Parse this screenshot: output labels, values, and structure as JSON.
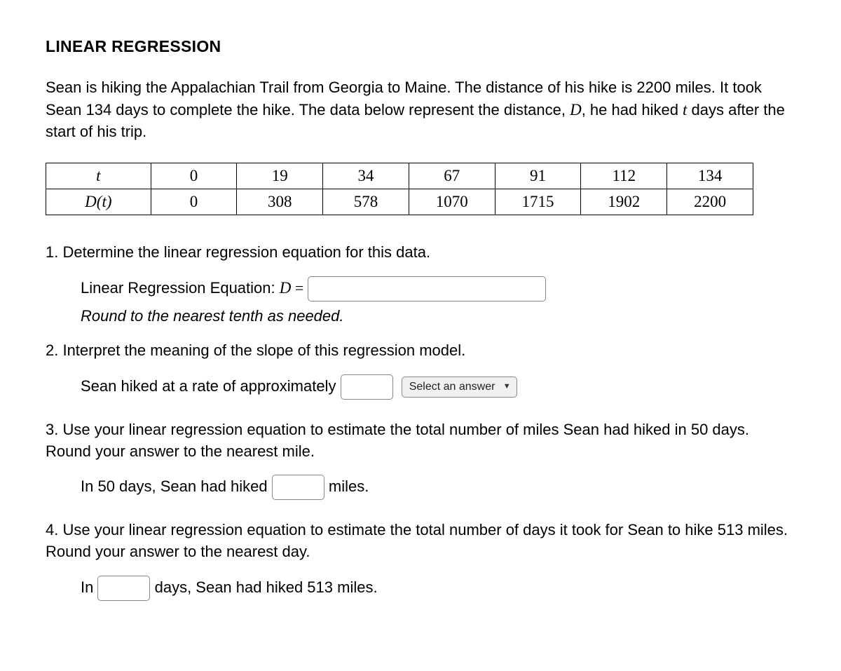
{
  "title": "LINEAR REGRESSION",
  "intro_p1": "Sean is hiking the Appalachian Trail from Georgia to Maine. The distance of his hike is 2200 miles. It took Sean 134 days to complete the hike. The data below represent the distance, ",
  "intro_var1": "D",
  "intro_p2": ", he had hiked ",
  "intro_var2": "t",
  "intro_p3": " days after the start of his trip.",
  "table": {
    "row1_header": "t",
    "row2_header": "D(t)",
    "row1": [
      "0",
      "19",
      "34",
      "67",
      "91",
      "112",
      "134"
    ],
    "row2": [
      "0",
      "308",
      "578",
      "1070",
      "1715",
      "1902",
      "2200"
    ]
  },
  "q1": {
    "prompt": "1. Determine the linear regression equation for this data.",
    "label_pre": "Linear Regression Equation: ",
    "label_var": "D",
    "equals": " = ",
    "hint": "Round to the nearest tenth as needed."
  },
  "q2": {
    "prompt": "2. Interpret the meaning of the slope of this regression model.",
    "text_pre": "Sean hiked at a rate of approximately ",
    "select_placeholder": "Select an answer"
  },
  "q3": {
    "prompt": "3. Use your linear regression equation to estimate the total number of miles Sean had hiked in 50 days. Round your answer to the nearest mile.",
    "text_pre": "In 50 days, Sean had hiked ",
    "text_post": " miles."
  },
  "q4": {
    "prompt": "4. Use your linear regression equation to estimate the total number of days it took for Sean to hike 513 miles. Round your answer to the nearest day.",
    "text_pre": "In ",
    "text_post": " days, Sean had hiked 513 miles."
  }
}
